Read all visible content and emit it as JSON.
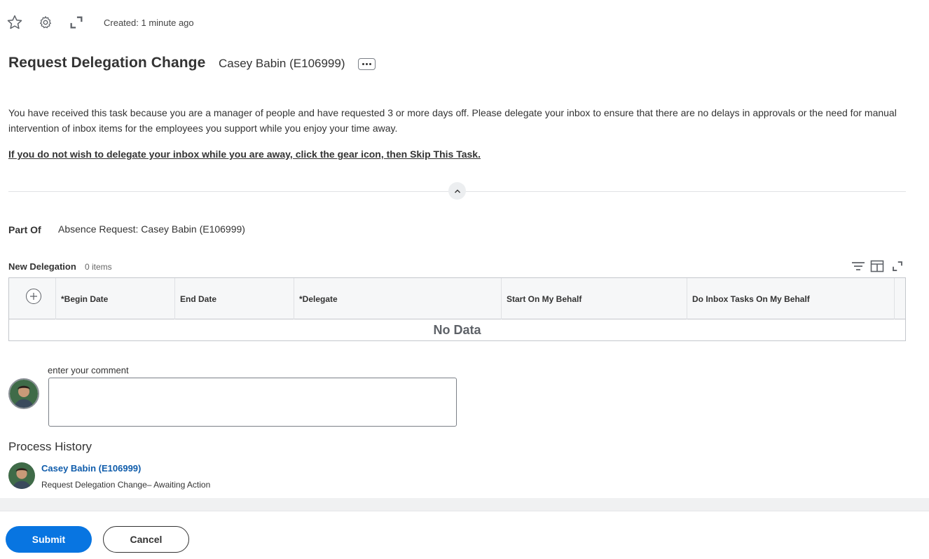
{
  "toolbar": {
    "icons": [
      "star-icon",
      "gear-icon",
      "expand-icon"
    ],
    "created_text": "Created: 1 minute ago"
  },
  "header": {
    "title": "Request Delegation Change",
    "worker": "Casey Babin (E106999)",
    "related_actions_icon": "more-horizontal-icon"
  },
  "instructions": {
    "text": "You have received this task because you are a manager of people and have requested 3 or more days off. Please delegate your inbox to ensure that there are no delays in approvals or the need for manual intervention of inbox items for the employees you support while you enjoy your time away.",
    "skip_note": "If you do not wish to delegate your inbox while you are away, click the gear icon, then Skip This Task."
  },
  "part_of": {
    "label": "Part Of",
    "value": "Absence Request: Casey Babin (E106999)"
  },
  "delegation_grid": {
    "title": "New Delegation",
    "count": "0 items",
    "tools": [
      "filter-icon",
      "columns-icon",
      "fullscreen-icon"
    ],
    "columns": [
      "*Begin Date",
      "End Date",
      "*Delegate",
      "Start On My Behalf",
      "Do Inbox Tasks On My Behalf"
    ],
    "empty_text": "No Data"
  },
  "comment": {
    "label": "enter your comment",
    "value": ""
  },
  "process_history": {
    "title": "Process History",
    "entries": [
      {
        "name": "Casey Babin (E106999)",
        "status": "Request Delegation Change– Awaiting Action"
      }
    ]
  },
  "footer": {
    "submit_label": "Submit",
    "cancel_label": "Cancel"
  },
  "colors": {
    "primary": "#0875e1",
    "link": "#0f5cab",
    "text": "#333333"
  }
}
